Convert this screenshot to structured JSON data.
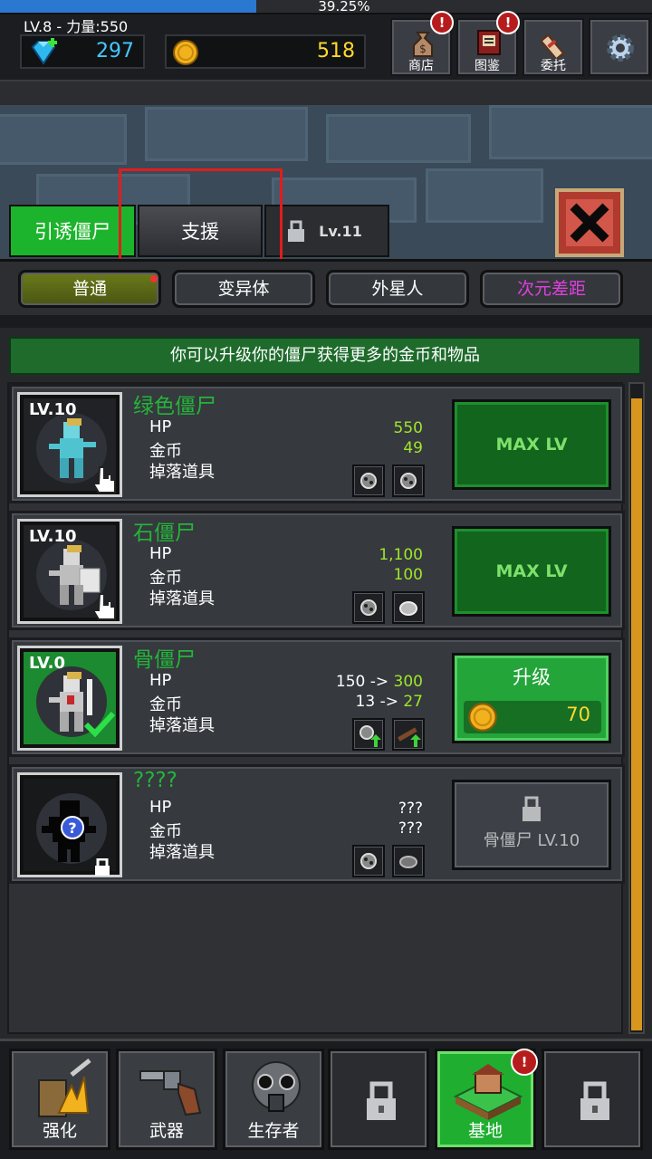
{
  "header": {
    "progress_text": "39.25%",
    "progress_fraction": 0.3925,
    "level_power": "LV.8 - 力量:550",
    "gems": "297",
    "coins": "518",
    "buttons": [
      {
        "label": "商店",
        "icon": "money-bag-icon",
        "alert": "!"
      },
      {
        "label": "图鉴",
        "icon": "book-icon",
        "alert": "!"
      },
      {
        "label": "委托",
        "icon": "scroll-icon"
      },
      {
        "label": "",
        "icon": "gear-icon"
      }
    ]
  },
  "tabs": {
    "lure": "引诱僵尸",
    "support": "支援",
    "locked": "Lv.11"
  },
  "subtabs": [
    "普通",
    "变异体",
    "外星人",
    "次元差距"
  ],
  "info_text": "你可以升级你的僵尸获得更多的金币和物品",
  "labels": {
    "hp": "HP",
    "gold": "金币",
    "drops": "掉落道具"
  },
  "zombies": [
    {
      "level": "LV.10",
      "name": "绿色僵尸",
      "hp": "550",
      "gold": "49",
      "action": "MAX LV"
    },
    {
      "level": "LV.10",
      "name": "石僵尸",
      "hp": "1,100",
      "gold": "100",
      "action": "MAX LV"
    },
    {
      "level": "LV.0",
      "name": "骨僵尸",
      "hp_from": "150 ->",
      "hp_to": "300",
      "gold_from": "13 ->",
      "gold_to": "27",
      "action": "升级",
      "cost": "70"
    },
    {
      "level": "",
      "name": "????",
      "hp": "???",
      "gold": "???",
      "action": "骨僵尸 LV.10"
    }
  ],
  "bottom_nav": [
    {
      "label": "强化",
      "icon": "upgrade-icon"
    },
    {
      "label": "武器",
      "icon": "revolver-icon"
    },
    {
      "label": "生存者",
      "icon": "gas-mask-icon"
    },
    {
      "label": "",
      "icon": "lock-icon"
    },
    {
      "label": "基地",
      "icon": "base-house-icon",
      "alert": "!"
    },
    {
      "label": "",
      "icon": "lock-icon"
    }
  ],
  "colors": {
    "accent_green": "#1db42d",
    "coin": "#ffd92e",
    "gem": "#45c8ff",
    "value_green": "#9ee72a",
    "highlight_red": "#e21c1c"
  }
}
